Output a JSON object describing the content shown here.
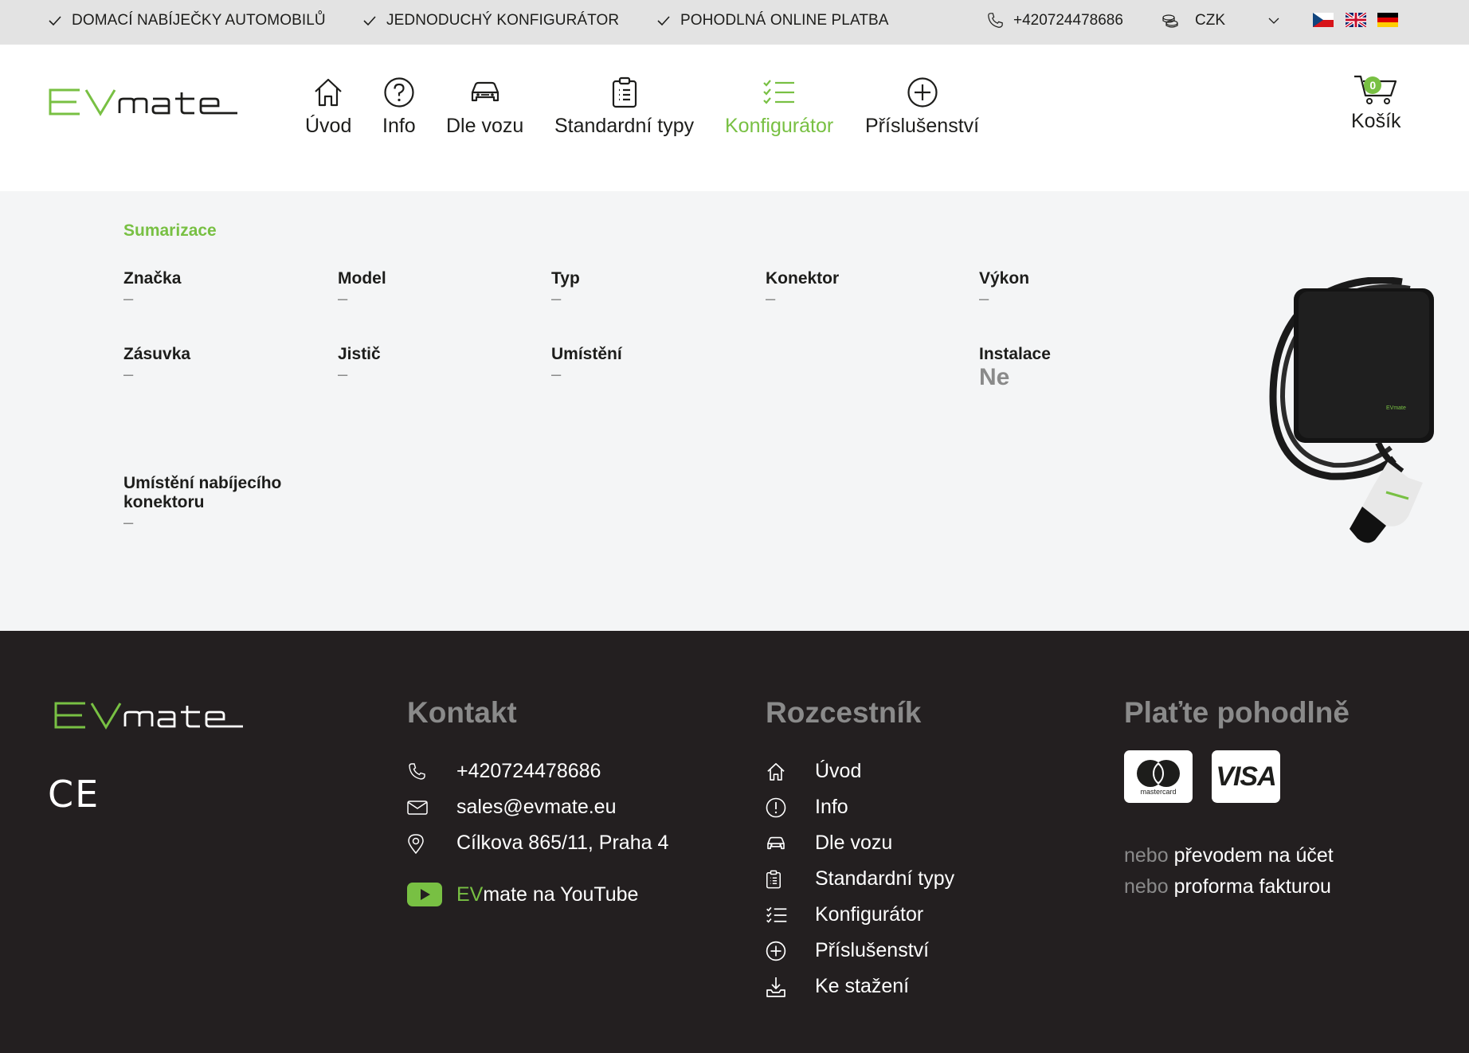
{
  "topbar": {
    "usp": [
      "DOMACÍ NABÍJEČKY AUTOMOBILŮ",
      "JEDNODUCHÝ KONFIGURÁTOR",
      "POHODLNÁ ONLINE PLATBA"
    ],
    "phone": "+420724478686",
    "currency": "CZK",
    "languages": [
      "cs-flag",
      "en-flag",
      "de-flag"
    ]
  },
  "header": {
    "logo_text": "EVmate",
    "nav": [
      {
        "label": "Úvod",
        "icon": "home-icon"
      },
      {
        "label": "Info",
        "icon": "question-icon"
      },
      {
        "label": "Dle vozu",
        "icon": "car-icon"
      },
      {
        "label": "Standardní typy",
        "icon": "clipboard-icon"
      },
      {
        "label": "Konfigurátor",
        "icon": "checklist-icon",
        "active": true
      },
      {
        "label": "Příslušenství",
        "icon": "plus-circle-icon"
      }
    ],
    "cart": {
      "label": "Košík",
      "count": "0"
    }
  },
  "summary": {
    "title": "Sumarizace",
    "fields": [
      {
        "label": "Značka",
        "value": "–"
      },
      {
        "label": "Model",
        "value": "–"
      },
      {
        "label": "Typ",
        "value": "–"
      },
      {
        "label": "Konektor",
        "value": "–"
      },
      {
        "label": "Výkon",
        "value": "–"
      },
      {
        "label": "Zásuvka",
        "value": "–"
      },
      {
        "label": "Jistič",
        "value": "–"
      },
      {
        "label": "Umístění",
        "value": "–"
      },
      {
        "label": "Instalace",
        "value": "Ne"
      },
      {
        "label": "Umístění nabíjecího konektoru",
        "value": "–"
      }
    ],
    "product_brand": "EVmate"
  },
  "footer": {
    "ce_mark": "CE",
    "contact": {
      "title": "Kontakt",
      "phone": "+420724478686",
      "email": "sales@evmate.eu",
      "address": "Cílkova 865/11, Praha 4",
      "youtube_brand": "EV",
      "youtube_rest": "mate na YouTube"
    },
    "nav": {
      "title": "Rozcestník",
      "items": [
        {
          "label": "Úvod",
          "icon": "home-icon"
        },
        {
          "label": "Info",
          "icon": "info-icon"
        },
        {
          "label": "Dle vozu",
          "icon": "car-icon"
        },
        {
          "label": "Standardní typy",
          "icon": "clipboard-icon"
        },
        {
          "label": "Konfigurátor",
          "icon": "checklist-icon"
        },
        {
          "label": "Příslušenství",
          "icon": "plus-circle-icon"
        },
        {
          "label": "Ke stažení",
          "icon": "download-icon"
        }
      ]
    },
    "payment": {
      "title": "Plaťte pohodlně",
      "mastercard_label": "mastercard",
      "visa_label": "VISA",
      "or_word": "nebo",
      "option1": "převodem na účet",
      "option2": "proforma fakturou"
    }
  },
  "colors": {
    "accent": "#78c043",
    "footer_bg": "#231f20",
    "topbar_bg": "#e3e3e3",
    "summary_bg": "#f4f5f6"
  }
}
